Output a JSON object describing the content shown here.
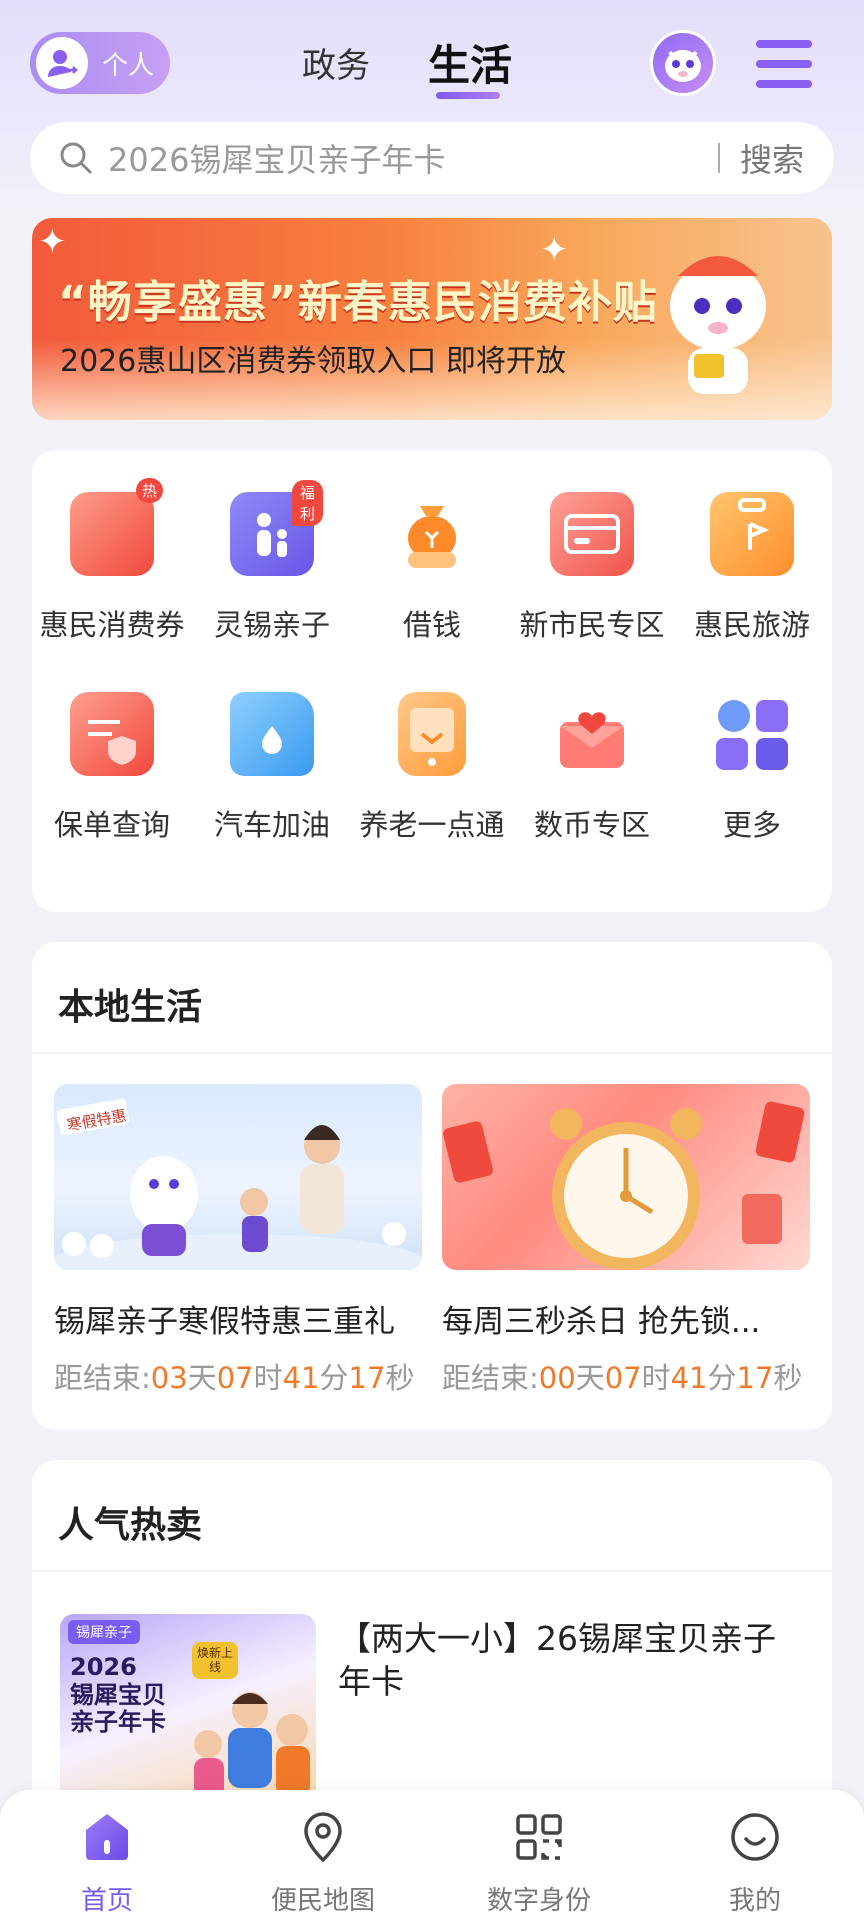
{
  "header": {
    "personal_label": "个人",
    "tabs": [
      {
        "label": "政务",
        "active": false
      },
      {
        "label": "生活",
        "active": true
      }
    ]
  },
  "search": {
    "placeholder": "2026锡犀宝贝亲子年卡",
    "button": "搜索"
  },
  "banner": {
    "title": "“畅享盛惠”新春惠民消费补贴",
    "subtitle": "2026惠山区消费券领取入口 即将开放"
  },
  "services": [
    {
      "label": "惠民消费券",
      "icon": "voucher-icon",
      "badge": "热"
    },
    {
      "label": "灵锡亲子",
      "icon": "parent-child-icon",
      "badge": "福利"
    },
    {
      "label": "借钱",
      "icon": "money-bag-icon",
      "badge": ""
    },
    {
      "label": "新市民专区",
      "icon": "card-icon",
      "badge": ""
    },
    {
      "label": "惠民旅游",
      "icon": "luggage-icon",
      "badge": ""
    },
    {
      "label": "保单查询",
      "icon": "policy-icon",
      "badge": ""
    },
    {
      "label": "汽车加油",
      "icon": "fuel-icon",
      "badge": ""
    },
    {
      "label": "养老一点通",
      "icon": "elderly-care-icon",
      "badge": ""
    },
    {
      "label": "数币专区",
      "icon": "red-envelope-icon",
      "badge": ""
    },
    {
      "label": "更多",
      "icon": "more-grid-icon",
      "badge": ""
    }
  ],
  "local_life": {
    "title": "本地生活",
    "promos": [
      {
        "title": "锡犀亲子寒假特惠三重礼",
        "img_text": "寒假特惠",
        "prefix": "距结束:",
        "d": "03",
        "h": "07",
        "m": "41",
        "s": "17",
        "u_d": "天",
        "u_h": "时",
        "u_m": "分",
        "u_s": "秒"
      },
      {
        "title": "每周三秒杀日 抢先锁...",
        "img_text": "",
        "prefix": "距结束:",
        "d": "00",
        "h": "07",
        "m": "41",
        "s": "17",
        "u_d": "天",
        "u_h": "时",
        "u_m": "分",
        "u_s": "秒"
      }
    ]
  },
  "hot": {
    "title": "人气热卖",
    "product": {
      "title": "【两大一小】26锡犀宝贝亲子年卡",
      "thumb_brand": "锡犀亲子",
      "thumb_year": "2026",
      "thumb_line1": "锡犀宝贝",
      "thumb_line2": "亲子年卡",
      "thumb_badge": "焕新上线"
    }
  },
  "tabbar": [
    {
      "label": "首页",
      "icon": "home-icon",
      "active": true
    },
    {
      "label": "便民地图",
      "icon": "map-pin-icon",
      "active": false
    },
    {
      "label": "数字身份",
      "icon": "qr-code-icon",
      "active": false
    },
    {
      "label": "我的",
      "icon": "smile-icon",
      "active": false
    }
  ],
  "colors": {
    "accent": "#7a5cf0",
    "countdown": "#f07a2a",
    "badge": "#f0483c"
  }
}
